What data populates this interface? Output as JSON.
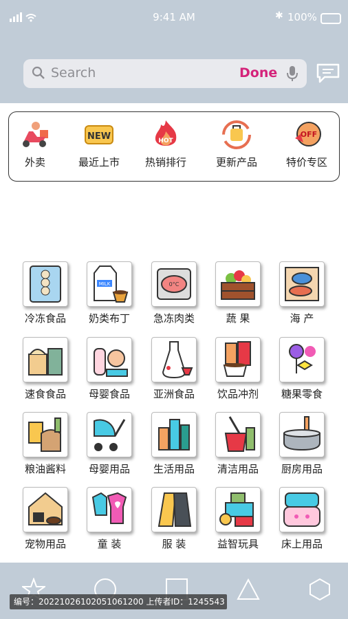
{
  "status_bar": {
    "time": "9:41 AM",
    "battery": "100%"
  },
  "search": {
    "placeholder": "Search",
    "done_label": "Done"
  },
  "quick_menu": [
    {
      "label": "外卖",
      "icon": "delivery-scooter-icon"
    },
    {
      "label": "最近上市",
      "icon": "new-badge-icon"
    },
    {
      "label": "热销排行",
      "icon": "hot-flame-icon"
    },
    {
      "label": "更新产品",
      "icon": "refresh-bag-icon"
    },
    {
      "label": "特价专区",
      "icon": "off-tag-icon"
    }
  ],
  "categories": [
    {
      "label": "冷冻食品",
      "icon": "frozen-dumplings-icon"
    },
    {
      "label": "奶类布丁",
      "icon": "milk-pudding-icon"
    },
    {
      "label": "急冻肉类",
      "icon": "frozen-meat-icon"
    },
    {
      "label": "蔬 果",
      "icon": "vegetables-crate-icon"
    },
    {
      "label": "海 产",
      "icon": "seafood-icon"
    },
    {
      "label": "速食食品",
      "icon": "instant-noodles-icon"
    },
    {
      "label": "母婴食品",
      "icon": "baby-bottle-icon"
    },
    {
      "label": "亚洲食品",
      "icon": "sake-bottle-icon"
    },
    {
      "label": "饮品冲剂",
      "icon": "soda-coffee-icon"
    },
    {
      "label": "糖果零食",
      "icon": "candy-icon"
    },
    {
      "label": "粮油酱料",
      "icon": "grain-oil-icon"
    },
    {
      "label": "母婴用品",
      "icon": "stroller-icon"
    },
    {
      "label": "生活用品",
      "icon": "toiletries-icon"
    },
    {
      "label": "清洁用品",
      "icon": "cleaning-bucket-icon"
    },
    {
      "label": "厨房用品",
      "icon": "cooking-pot-icon"
    },
    {
      "label": "宠物用品",
      "icon": "pet-house-icon"
    },
    {
      "label": "童 装",
      "icon": "kids-clothes-icon"
    },
    {
      "label": "服 装",
      "icon": "clothing-icon"
    },
    {
      "label": "益智玩具",
      "icon": "toy-blocks-icon"
    },
    {
      "label": "床上用品",
      "icon": "bedding-icon"
    }
  ],
  "tab_bar": [
    "star-icon",
    "circle-icon",
    "square-icon",
    "triangle-icon",
    "hexagon-icon"
  ],
  "watermark": "编号：20221026102051061200 上传者ID：1245543",
  "colors": {
    "header_bg": "#c1ccd7",
    "accent": "#d4237a"
  }
}
